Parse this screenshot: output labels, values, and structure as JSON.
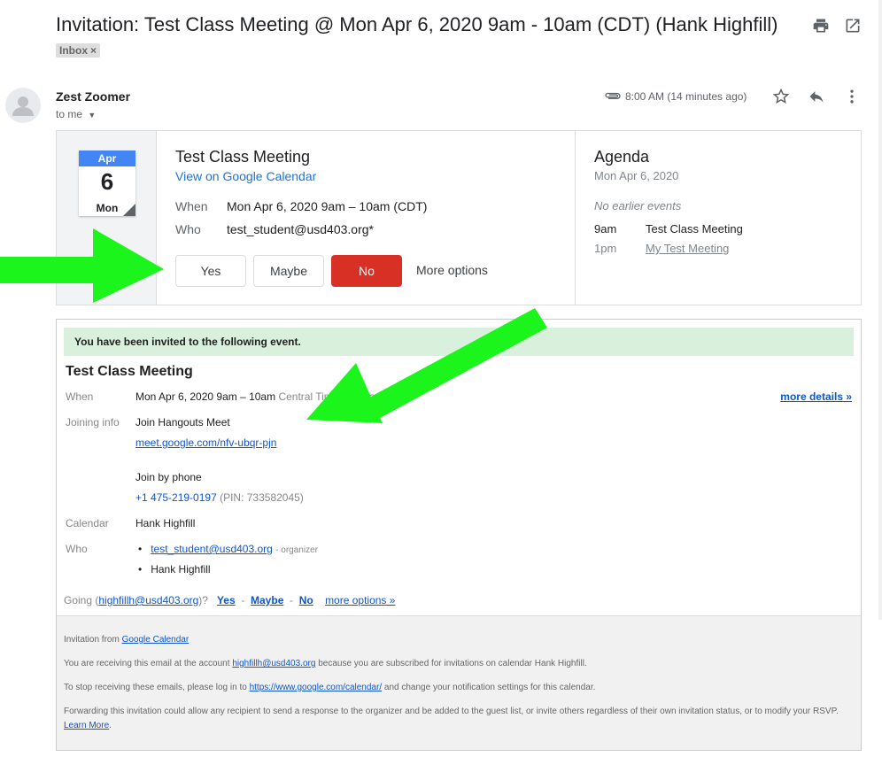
{
  "header": {
    "subject": "Invitation: Test Class Meeting @ Mon Apr 6, 2020 9am - 10am (CDT) (Hank Highfill)",
    "label": "Inbox",
    "label_remove": "×"
  },
  "message": {
    "sender": "Zest Zoomer",
    "to": "to me",
    "time": "8:00 AM (14 minutes ago)"
  },
  "invite": {
    "cal_month": "Apr",
    "cal_day": "6",
    "cal_weekday": "Mon",
    "title": "Test Class Meeting",
    "view_link": "View on Google Calendar",
    "when_label": "When",
    "when_value": "Mon Apr 6, 2020 9am – 10am (CDT)",
    "who_label": "Who",
    "who_value": "test_student@usd403.org*",
    "rsvp_yes": "Yes",
    "rsvp_maybe": "Maybe",
    "rsvp_no": "No",
    "more_options": "More options"
  },
  "agenda": {
    "title": "Agenda",
    "date": "Mon Apr 6, 2020",
    "no_earlier": "No earlier events",
    "items": [
      {
        "time": "9am",
        "name": "Test Class Meeting"
      },
      {
        "time": "1pm",
        "name": "My Test Meeting"
      }
    ]
  },
  "invitation": {
    "banner": "You have been invited to the following event.",
    "title": "Test Class Meeting",
    "when_label": "When",
    "when_value": "Mon Apr 6, 2020 9am – 10am",
    "when_tz": "Central Time - Chicago",
    "more_details": "more details »",
    "joining_label": "Joining info",
    "join_hangouts": "Join Hangouts Meet",
    "meet_link": "meet.google.com/nfv-ubqr-pjn",
    "join_phone": "Join by phone",
    "phone": "+1 475-219-0197",
    "pin": "(PIN: 733582045)",
    "calendar_label": "Calendar",
    "calendar_value": "Hank Highfill",
    "who_label": "Who",
    "who_organizer": "test_student@usd403.org",
    "organizer_tag": "- organizer",
    "who_guest": "Hank Highfill",
    "going_prefix": "Going (",
    "going_email": "highfillh@usd403.org",
    "going_suffix": ")?",
    "going_yes": "Yes",
    "going_maybe": "Maybe",
    "going_no": "No",
    "going_more": "more options »"
  },
  "footer": {
    "line1_prefix": "Invitation from",
    "line1_link": "Google Calendar",
    "line2_a": "You are receiving this email at the account",
    "line2_link": "highfillh@usd403.org",
    "line2_b": "because you are subscribed for invitations on calendar Hank Highfill.",
    "line3_a": "To stop receiving these emails, please log in to",
    "line3_link": "https://www.google.com/calendar/",
    "line3_b": "and change your notification settings for this calendar.",
    "line4": "Forwarding this invitation could allow any recipient to send a response to the organizer and be added to the guest list, or invite others regardless of their own invitation status, or to modify your RSVP.",
    "line4_link": "Learn More"
  },
  "icons": [
    "print-icon",
    "open-in-new-icon",
    "attachment-icon",
    "star-icon",
    "reply-icon",
    "more-vert-icon",
    "avatar-icon",
    "dropdown-icon"
  ],
  "colors": {
    "accent_blue": "#1a73e8",
    "rsvp_no_red": "#d93025",
    "banner_green": "#d9f0dc",
    "arrow_green": "#1bf51b"
  }
}
